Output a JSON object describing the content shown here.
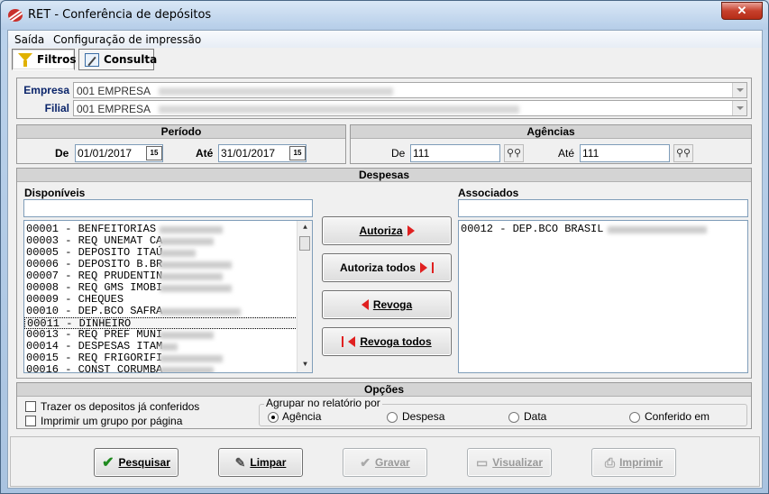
{
  "window": {
    "title": "RET - Conferência de depósitos",
    "close_label": "✕"
  },
  "menu": {
    "items": [
      "Saída",
      "Configuração de impressão"
    ]
  },
  "tabs": [
    {
      "label": "Filtros",
      "icon": "filter-icon"
    },
    {
      "label": "Consulta",
      "icon": "edit-note-icon"
    }
  ],
  "empresa": {
    "label": "Empresa",
    "value": "001 EMPRESA"
  },
  "filial": {
    "label": "Filial",
    "value": "001 EMPRESA"
  },
  "periodo": {
    "title": "Período",
    "de_label": "De",
    "de_value": "01/01/2017",
    "ate_label": "Até",
    "ate_value": "31/01/2017",
    "calendar_label": "15"
  },
  "agencias": {
    "title": "Agências",
    "de_label": "De",
    "de_value": "111",
    "ate_label": "Até",
    "ate_value": "111"
  },
  "despesas": {
    "title": "Despesas",
    "disponiveis_label": "Disponíveis",
    "associados_label": "Associados",
    "disponiveis": [
      "00001 - BENFEITORIAS",
      "00003 - REQ UNEMAT CA",
      "00005 - DEPOSITO ITAÚ",
      "00006 - DEPOSITO B.BR",
      "00007 - REQ PRUDENTIN",
      "00008 - REQ GMS IMOBI",
      "00009 - CHEQUES",
      "00010 - DEP.BCO SAFRA",
      "00011 - DINHEIRO",
      "00013 - REQ PREF MUNI",
      "00014 - DESPESAS ITAM",
      "00015 - REQ FRIGORIFI",
      "00016 - CONST CORUMBA"
    ],
    "selected_index": 8,
    "associados": [
      "00012 - DEP.BCO BRASIL"
    ]
  },
  "buttons": {
    "autoriza": "Autoriza",
    "autoriza_todos": "Autoriza todos",
    "revoga": "Revoga",
    "revoga_todos": "Revoga todos"
  },
  "opcoes": {
    "title": "Opções",
    "check1": "Trazer os depositos já conferidos",
    "check2": "Imprimir um grupo por página",
    "group_title": "Agrupar no relatório por",
    "radios": [
      "Agência",
      "Despesa",
      "Data",
      "Conferido em"
    ],
    "selected_radio": 0
  },
  "footer": {
    "pesquisar": "Pesquisar",
    "limpar": "Limpar",
    "gravar": "Gravar",
    "visualizar": "Visualizar",
    "imprimir": "Imprimir"
  },
  "colors": {
    "header_gray": "#d4d4d4",
    "label_blue": "#0a246a",
    "accent_red": "#e02020"
  }
}
